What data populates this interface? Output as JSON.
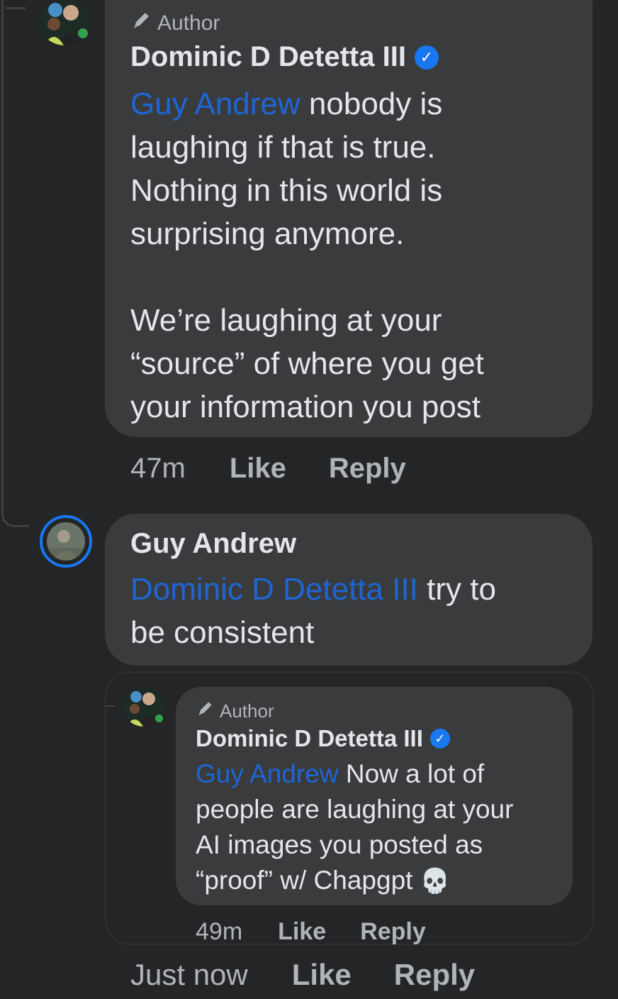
{
  "comment1": {
    "author_tag": "Author",
    "name": "Dominic D Detetta III",
    "mention": "Guy Andrew",
    "text_lines": [
      " nobody is",
      "laughing if that is true.",
      "Nothing in this world is",
      "surprising anymore.",
      "",
      "We’re laughing at your",
      "“source” of where you get",
      "your information you post"
    ],
    "time": "47m",
    "like": "Like",
    "reply": "Reply"
  },
  "comment2": {
    "name": "Guy Andrew",
    "mention": "Dominic D Detetta III",
    "text_after_mention": " try to",
    "text_line2": "be consistent",
    "time": "Just now",
    "like": "Like",
    "reply": "Reply"
  },
  "quoted_reply": {
    "author_tag": "Author",
    "name": "Dominic D Detetta III",
    "mention": "Guy Andrew",
    "text_lines": [
      " Now a lot of",
      "people are laughing at your",
      "AI images you posted as",
      "“proof” w/ Chapgpt "
    ],
    "emoji": "💀",
    "time": "49m",
    "like": "Like",
    "reply": "Reply"
  },
  "colors": {
    "background": "#242527",
    "bubble": "#3a3b3c",
    "mention": "#1d66d6",
    "verified": "#1877f2",
    "online": "#31a24c"
  }
}
